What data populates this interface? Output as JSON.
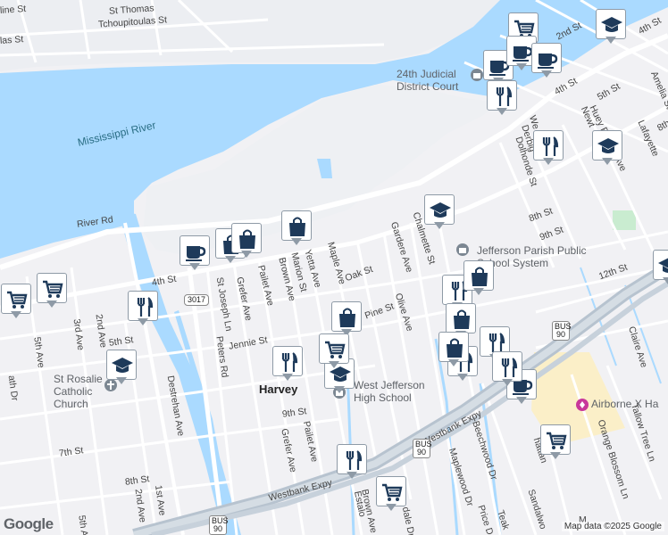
{
  "map": {
    "attribution": "Map data ©2025 Google",
    "logo": "Google",
    "colors": {
      "water": "#aadaff",
      "land": "#f1f1f4",
      "road": "#ffffff",
      "highway": "#b7c3cf",
      "marker_fill": "#1e3a5a",
      "marker_border": "#8e9aa6",
      "park": "#c9ecd0",
      "commercial": "#fbefc8"
    }
  },
  "labels": {
    "river": "Mississippi River",
    "harvey": "Harvey",
    "jud_court": "24th Judicial District Court",
    "jpss": "Jefferson Parish Public School System",
    "wjhs": "West Jefferson High School",
    "st_rosalie": "St Rosalie Catholic Church",
    "airborne": "Airborne X Ha",
    "river_rd": "River Rd",
    "fourth_st": "4th St",
    "fourth_st_ne": "4th St",
    "fifth_st": "5th St",
    "fifth_st_ne": "5th St",
    "eighth_st": "8th St",
    "ninth_st": "9th St",
    "ninth_st_ne": "9th St",
    "twelfth_st": "12th St",
    "jennie_st": "Jennie St",
    "oak_st": "Oak St",
    "pine_st": "Pine St",
    "seventh_st": "7th St",
    "eighth_st_sw": "8th St",
    "ninth_st_c": "9th St",
    "second_st": "2nd St",
    "fourth_st_nw": "4th St",
    "tchoup": "Tchoupitoulas St",
    "st_thomas": "St Thomas",
    "las_st": "las St",
    "line_st": "line St",
    "westbank_expy": "Westbank Expy",
    "westbank_expy2": "Westbank Expy",
    "peters_rd": "Peters Rd",
    "st_joseph_ln": "St Joseph Ln",
    "grefer_ave": "Grefer Ave",
    "grefer_ave2": "Grefer Ave",
    "pailet_ave": "Pailet Ave",
    "pailet_ave2": "Pailet Ave",
    "brown_ave": "Brown Ave",
    "brown_ave2": "Brown Ave",
    "marion_st": "Marion St",
    "yetta_ave": "Yetta Ave",
    "maple_ave": "Maple Ave",
    "gardere_ave": "Gardere Ave",
    "chalmette_st": "Chalmette St",
    "olive_ave": "Olive Ave",
    "destrehan_ave": "Destrehan Ave",
    "fifth_ave": "5th Ave",
    "fifth_ave2": "5th Ave",
    "third_ave": "3rd Ave",
    "second_ave": "2nd Ave",
    "second_ave2": "2nd Ave",
    "first_ave": "1st Ave",
    "beechwood_dr": "Beechwood Dr",
    "maplewood_dr": "Maplewood Dr",
    "price_dr": "Price D",
    "teak": "Teak",
    "sandalwo": "Sandalwo",
    "orange_blossom": "Orange Blossom Ln",
    "tallow_tree": "Tallow Tree Ln",
    "claire_ave": "Claire Ave",
    "dolhonde_st": "Dolhonde St",
    "derbigny": "Derbig",
    "huey_p_long": "Huey P Long Ave",
    "lafayette": "Lafayette",
    "newton": "Newt",
    "amelia_st": "Amelia St",
    "eighth_st_ne": "8th",
    "fourth_st_ne2": "4th St",
    "hattan": "hattan",
    "estalo": "Estalo",
    "dale_dr": "dale Dr",
    "ath_dr": "ath Dr",
    "second_st_ne": "2nd St",
    "we_st": "We",
    "m_st": "M",
    "one_st": "1"
  },
  "shields": [
    {
      "id": "3017",
      "text": "3017"
    },
    {
      "id": "bus90a",
      "text": "BUS 90"
    },
    {
      "id": "bus90b",
      "text": "BUS 90"
    },
    {
      "id": "bus90c",
      "text": "BUS 90"
    }
  ],
  "markers": [
    {
      "name": "grocery-marker",
      "icon": "cart"
    },
    {
      "name": "grocery-marker",
      "icon": "cart"
    },
    {
      "name": "grocery-marker",
      "icon": "cart"
    },
    {
      "name": "cafe-marker",
      "icon": "cup"
    },
    {
      "name": "cafe-marker",
      "icon": "cup"
    },
    {
      "name": "cafe-marker",
      "icon": "cup"
    },
    {
      "name": "cafe-marker",
      "icon": "cup"
    },
    {
      "name": "cafe-marker",
      "icon": "cup"
    },
    {
      "name": "restaurant-marker",
      "icon": "fork-knife"
    },
    {
      "name": "restaurant-marker",
      "icon": "fork-knife"
    },
    {
      "name": "restaurant-marker",
      "icon": "fork-knife"
    },
    {
      "name": "restaurant-marker",
      "icon": "fork-knife"
    },
    {
      "name": "restaurant-marker",
      "icon": "fork-knife"
    },
    {
      "name": "restaurant-marker",
      "icon": "fork-knife"
    },
    {
      "name": "restaurant-marker",
      "icon": "fork-knife"
    },
    {
      "name": "restaurant-marker",
      "icon": "fork-knife"
    },
    {
      "name": "restaurant-marker",
      "icon": "fork-knife"
    },
    {
      "name": "shop-marker",
      "icon": "bag"
    },
    {
      "name": "shop-marker",
      "icon": "bag"
    },
    {
      "name": "shop-marker",
      "icon": "bag"
    },
    {
      "name": "shop-marker",
      "icon": "bag"
    },
    {
      "name": "shop-marker",
      "icon": "bag"
    },
    {
      "name": "shop-marker",
      "icon": "bag"
    },
    {
      "name": "shop-marker",
      "icon": "bag"
    },
    {
      "name": "school-marker",
      "icon": "cap"
    },
    {
      "name": "school-marker",
      "icon": "cap"
    },
    {
      "name": "school-marker",
      "icon": "cap"
    },
    {
      "name": "school-marker",
      "icon": "cap"
    },
    {
      "name": "school-marker",
      "icon": "cap"
    },
    {
      "name": "school-marker",
      "icon": "cap"
    },
    {
      "name": "grocery-marker",
      "icon": "cart"
    },
    {
      "name": "grocery-marker",
      "icon": "cart"
    },
    {
      "name": "grocery-marker",
      "icon": "cart"
    },
    {
      "name": "grocery-marker",
      "icon": "cart"
    },
    {
      "name": "grocery-marker",
      "icon": "cart"
    },
    {
      "name": "cafe-marker",
      "icon": "cup"
    }
  ]
}
